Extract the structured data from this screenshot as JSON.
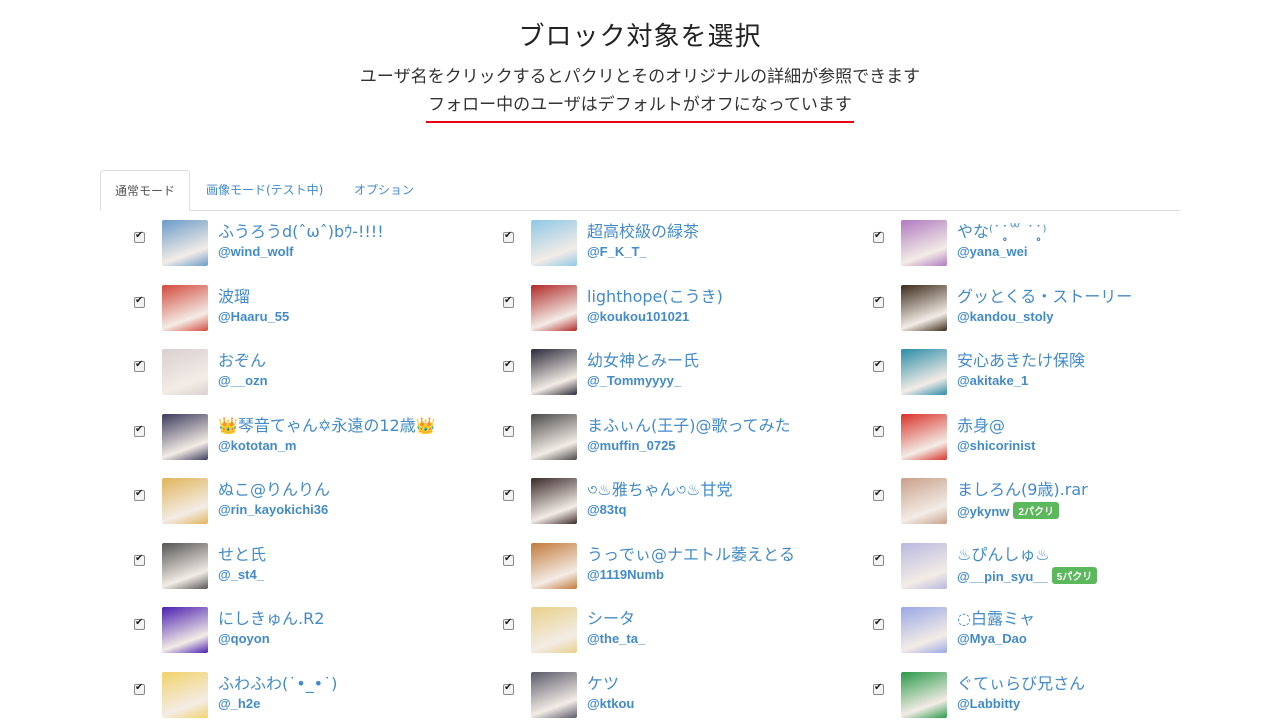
{
  "header": {
    "title": "ブロック対象を選択",
    "line1": "ユーザ名をクリックするとパクリとそのオリジナルの詳細が参照できます",
    "line2": "フォロー中のユーザはデフォルトがオフになっています"
  },
  "tabs": [
    {
      "label": "通常モード",
      "active": true
    },
    {
      "label": "画像モード(テスト中)",
      "active": false
    },
    {
      "label": "オプション",
      "active": false
    }
  ],
  "columns": [
    [
      {
        "name": "ふうろうd(ˆωˆ)bｳ-!!!!",
        "handle": "@wind_wolf",
        "checked": true,
        "color": "#6a9bc9"
      },
      {
        "name": "波瑠",
        "handle": "@Haaru_55",
        "checked": true,
        "color": "#d24a3c"
      },
      {
        "name": "おぞん",
        "handle": "@__ozn",
        "checked": true,
        "color": "#d9cfd0"
      },
      {
        "name": "👑琴音てゃん✡永遠の12歳👑",
        "handle": "@kototan_m",
        "checked": true,
        "color": "#3c3c5c"
      },
      {
        "name": "ぬこ@りんりん",
        "handle": "@rin_kayokichi36",
        "checked": true,
        "color": "#e0b45a"
      },
      {
        "name": "せと氏",
        "handle": "@_st4_",
        "checked": true,
        "color": "#555555"
      },
      {
        "name": "にしきゅん.R2",
        "handle": "@qoyon",
        "checked": true,
        "color": "#4a1fb0"
      },
      {
        "name": "ふわふわ(˙•_•˙)",
        "handle": "@_h2e",
        "checked": true,
        "color": "#f2d26a"
      }
    ],
    [
      {
        "name": "超高校級の緑茶",
        "handle": "@F_K_T_",
        "checked": true,
        "color": "#8fc7e6"
      },
      {
        "name": "lighthope(こうき)",
        "handle": "@koukou101021",
        "checked": true,
        "color": "#b02a2a"
      },
      {
        "name": "幼女神とみー氏",
        "handle": "@_Tommyyyy_",
        "checked": true,
        "color": "#2b2b3a"
      },
      {
        "name": "まふぃん(王子)@歌ってみた",
        "handle": "@muffin_0725",
        "checked": true,
        "color": "#4a4a4a"
      },
      {
        "name": "৩♨雅ちゃん৩♨甘党",
        "handle": "@83tq",
        "checked": true,
        "color": "#3a2a2a"
      },
      {
        "name": "うっでぃ@ナエトル萎えとる",
        "handle": "@1119Numb",
        "checked": true,
        "color": "#c27a3a"
      },
      {
        "name": "シータ",
        "handle": "@the_ta_",
        "checked": true,
        "color": "#e8d08a"
      },
      {
        "name": "ケツ",
        "handle": "@ktkou",
        "checked": true,
        "color": "#5a5a6a"
      }
    ],
    [
      {
        "name": "やな⁽˙˙̥̥꒳ ˙˙̥̥⁾",
        "handle": "@yana_wei",
        "checked": true,
        "color": "#b07ac0"
      },
      {
        "name": "グッとくる・ストーリー",
        "handle": "@kandou_stoly",
        "checked": true,
        "color": "#3a2a1a"
      },
      {
        "name": "安心あきたけ保険",
        "handle": "@akitake_1",
        "checked": true,
        "color": "#2a8ca8"
      },
      {
        "name": "赤身@",
        "handle": "@shicorinist",
        "checked": true,
        "color": "#d8322a"
      },
      {
        "name": "ましろん(9歳).rar",
        "handle": "@ykynw",
        "checked": true,
        "badge": "2パクリ",
        "color": "#c8a08a"
      },
      {
        "name": "♨ぴんしゅ♨",
        "handle": "@__pin_syu__",
        "checked": true,
        "badge": "5パクリ",
        "color": "#b8b8e0"
      },
      {
        "name": "◌白露ミャ",
        "handle": "@Mya_Dao",
        "checked": true,
        "color": "#9aa8e6"
      },
      {
        "name": "ぐてぃらび兄さん",
        "handle": "@Labbitty",
        "checked": true,
        "color": "#2a9a4a"
      }
    ]
  ]
}
